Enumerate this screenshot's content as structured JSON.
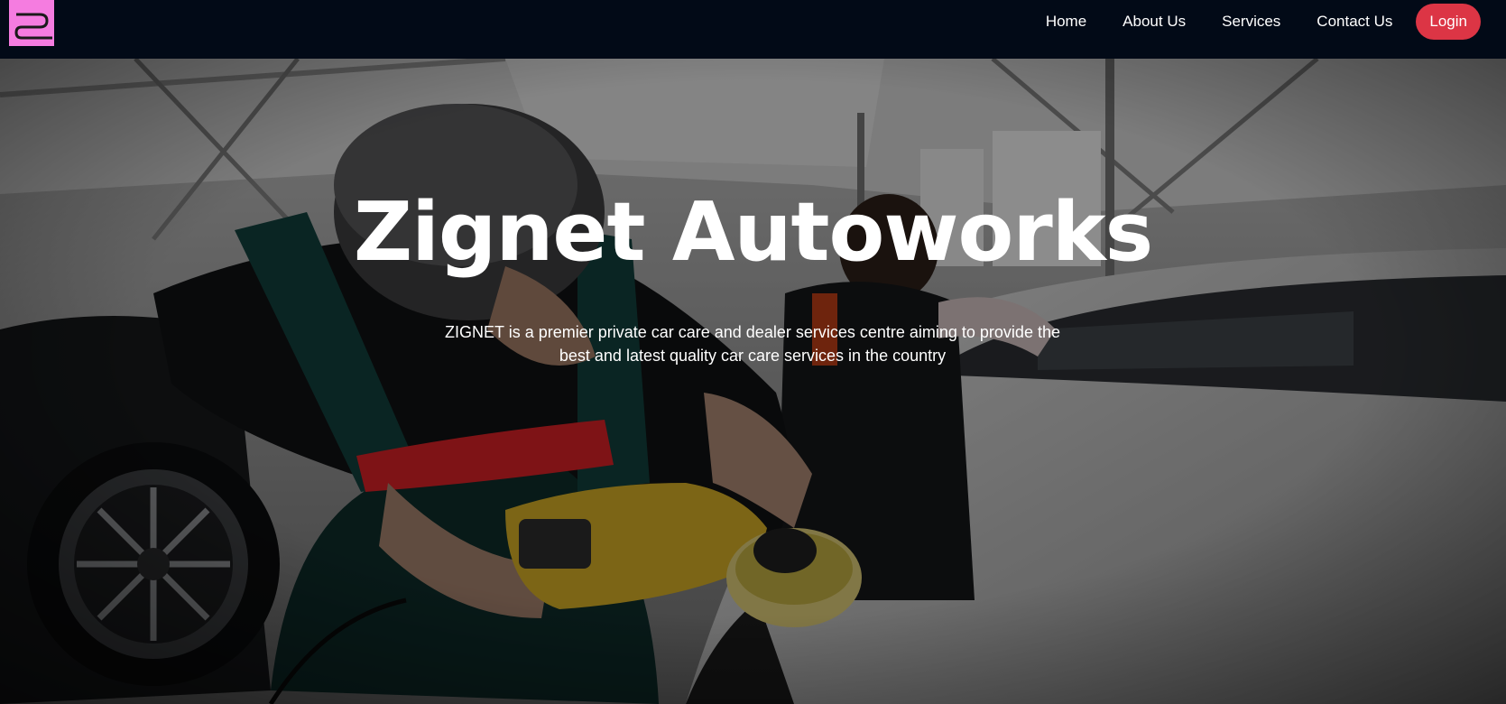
{
  "header": {
    "logo_icon": "zignet-logo-icon",
    "brand_color": "#f57ce0",
    "nav": [
      {
        "label": "Home"
      },
      {
        "label": "About Us"
      },
      {
        "label": "Services"
      },
      {
        "label": "Contact Us"
      }
    ],
    "login_label": "Login",
    "login_color": "#dc3545"
  },
  "hero": {
    "title": "Zignet Autoworks",
    "subtitle": "ZIGNET is a premier private car care and dealer services centre aiming to provide the best and latest quality car care services in the country"
  }
}
